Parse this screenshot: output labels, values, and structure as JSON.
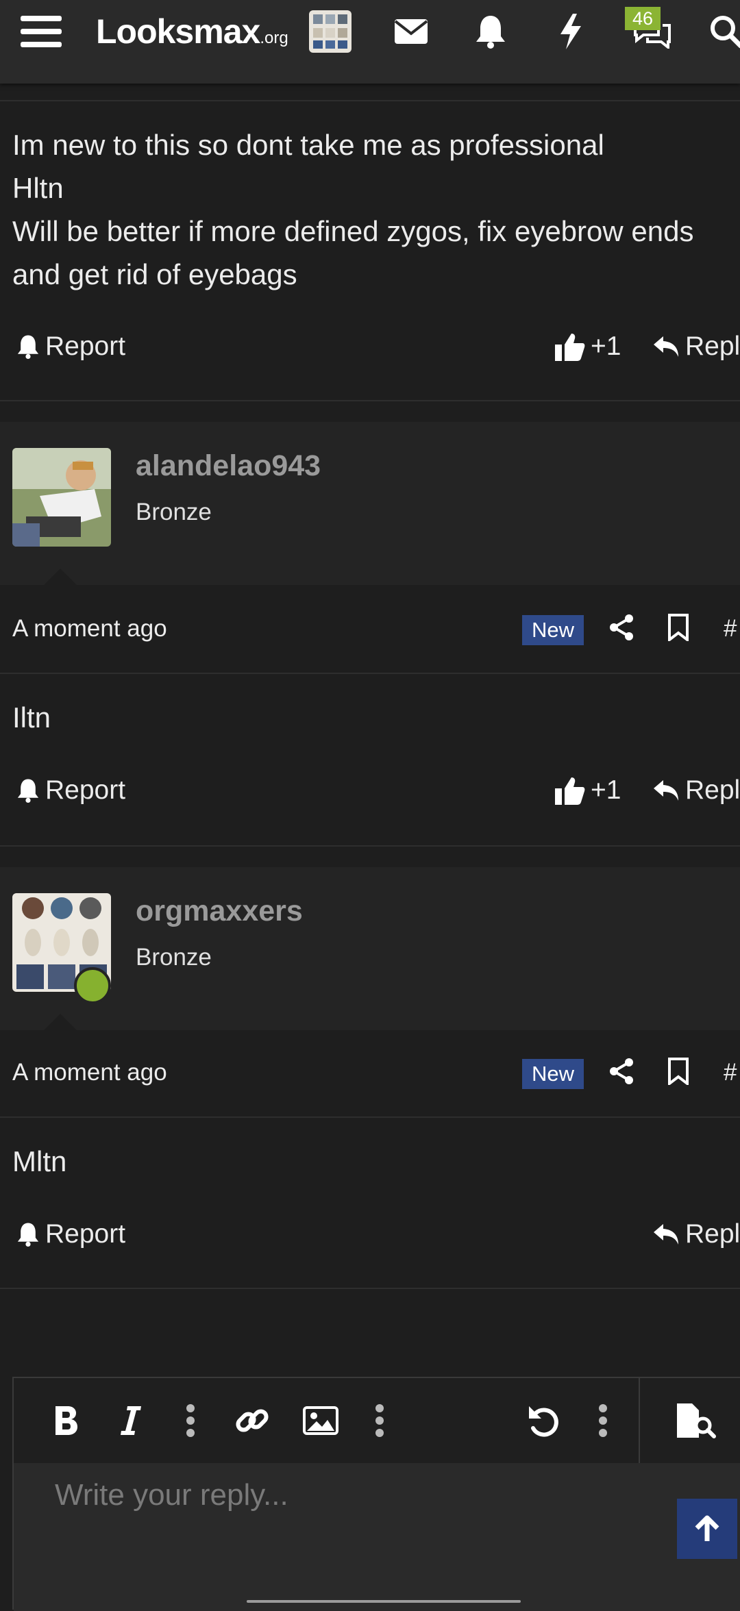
{
  "header": {
    "logo_main": "Looksmax",
    "logo_suffix": ".org",
    "alerts_count": "46",
    "icons": [
      "menu-icon",
      "avatar-thumbnail",
      "envelope-icon",
      "bell-icon",
      "lightning-icon",
      "chat-icon",
      "search-icon"
    ]
  },
  "posts": [
    {
      "body_lines": [
        "Im new to this so dont take me as professional",
        "Hltn",
        "Will be better if more defined zygos, fix eyebrow ends",
        "and get rid of eyebags"
      ],
      "report_label": "Report",
      "like_count": "+1",
      "reply_label": "Reply"
    },
    {
      "username": "alandelao943",
      "user_title": "Bronze",
      "time": "A moment ago",
      "new_badge": "New",
      "permalink": "#",
      "body": "Iltn",
      "report_label": "Report",
      "like_count": "+1",
      "reply_label": "Reply"
    },
    {
      "username": "orgmaxxers",
      "user_title": "Bronze",
      "time": "A moment ago",
      "new_badge": "New",
      "permalink": "#",
      "body": "Mltn",
      "report_label": "Report",
      "reply_label": "Reply"
    }
  ],
  "editor": {
    "placeholder": "Write your reply...",
    "toolbar": [
      "bold-icon",
      "italic-icon",
      "more-icon",
      "link-icon",
      "image-icon",
      "more-icon",
      "undo-icon",
      "more-icon",
      "preview-icon"
    ]
  },
  "colors": {
    "background": "#1e1e1e",
    "header": "#2a2a2a",
    "new_badge": "#2f4a8a",
    "online": "#86b12f",
    "alerts_badge": "#8bb434"
  }
}
